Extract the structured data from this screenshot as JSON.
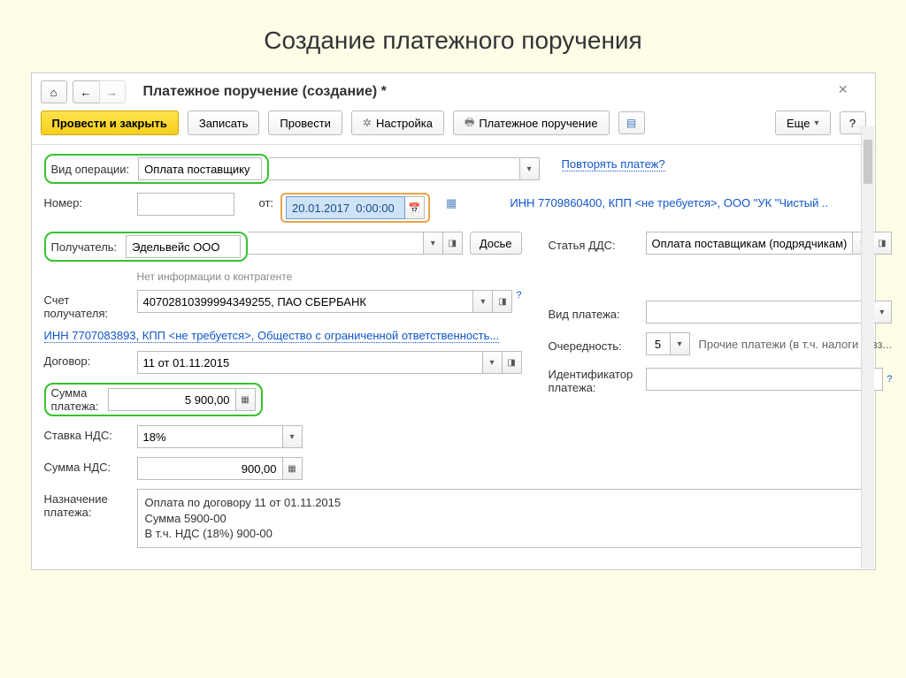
{
  "page": {
    "title": "Создание платежного поручения"
  },
  "window": {
    "title": "Платежное поручение (создание) *"
  },
  "toolbar": {
    "post_close": "Провести и закрыть",
    "save": "Записать",
    "post": "Провести",
    "settings": "Настройка",
    "template": "Платежное поручение",
    "more": "Еще",
    "help": "?"
  },
  "fields": {
    "op_type_label": "Вид операции:",
    "op_type_value": "Оплата поставщику",
    "repeat_link": "Повторять платеж?",
    "number_label": "Номер:",
    "number_value": "",
    "from_label": "от:",
    "date_value": "20.01.2017  0:00:00",
    "inn_link": "ИНН 7709860400, КПП <не требуется>, ООО \"УК \"Чистый ...",
    "recipient_label": "Получатель:",
    "recipient_value": "Эдельвейс ООО",
    "dossier": "Досье",
    "no_info": "Нет информации о контрагенте",
    "account_label": "Счет\nполучателя:",
    "account_value": "40702810399994349255, ПАО СБЕРБАНК",
    "org_link": "ИНН 7707083893, КПП <не требуется>, Общество с ограниченной ответственность...",
    "contract_label": "Договор:",
    "contract_value": "11 от 01.11.2015",
    "sum_label": "Сумма\nплатежа:",
    "sum_value": "5 900,00",
    "vat_rate_label": "Ставка НДС:",
    "vat_rate_value": "18%",
    "vat_sum_label": "Сумма НДС:",
    "vat_sum_value": "900,00",
    "purpose_label": "Назначение\nплатежа:",
    "purpose_value": "Оплата по договору 11 от 01.11.2015\nСумма 5900-00\nВ т.ч. НДС  (18%) 900-00",
    "dds_label": "Статья ДДС:",
    "dds_value": "Оплата поставщикам (подрядчикам)",
    "ptype_label": "Вид платежа:",
    "ptype_value": "",
    "order_label": "Очередность:",
    "order_value": "5",
    "order_note": "Прочие платежи (в т.ч. налоги и вз...",
    "ident_label": "Идентификатор\nплатежа:",
    "ident_value": ""
  }
}
